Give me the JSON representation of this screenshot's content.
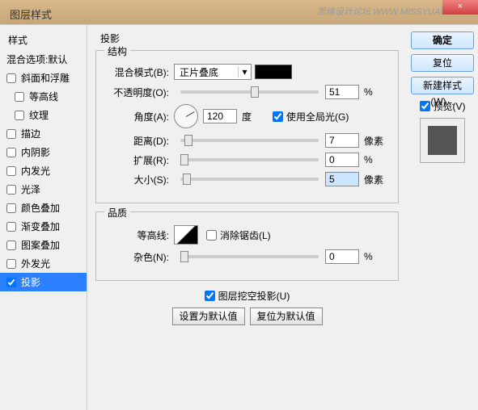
{
  "titlebar": {
    "title": "图层样式",
    "watermark": "思缘设计论坛 WWW.MISSYUAN.COM",
    "close": "×"
  },
  "sidebar": {
    "heading": "样式",
    "blend_defaults": "混合选项:默认",
    "items": [
      {
        "label": "斜面和浮雕",
        "checked": false
      },
      {
        "label": "等高线",
        "checked": false,
        "indent": true
      },
      {
        "label": "纹理",
        "checked": false,
        "indent": true
      },
      {
        "label": "描边",
        "checked": false
      },
      {
        "label": "内阴影",
        "checked": false
      },
      {
        "label": "内发光",
        "checked": false
      },
      {
        "label": "光泽",
        "checked": false
      },
      {
        "label": "颜色叠加",
        "checked": false
      },
      {
        "label": "渐变叠加",
        "checked": false
      },
      {
        "label": "图案叠加",
        "checked": false
      },
      {
        "label": "外发光",
        "checked": false
      },
      {
        "label": "投影",
        "checked": true,
        "selected": true
      }
    ]
  },
  "main": {
    "title": "投影",
    "structure": {
      "legend": "结构",
      "blend_mode_label": "混合模式(B):",
      "blend_mode_value": "正片叠底",
      "opacity_label": "不透明度(O):",
      "opacity_value": "51",
      "opacity_unit": "%",
      "angle_label": "角度(A):",
      "angle_value": "120",
      "angle_unit": "度",
      "global_light_label": "使用全局光(G)",
      "global_light_checked": true,
      "distance_label": "距离(D):",
      "distance_value": "7",
      "distance_unit": "像素",
      "spread_label": "扩展(R):",
      "spread_value": "0",
      "spread_unit": "%",
      "size_label": "大小(S):",
      "size_value": "5",
      "size_unit": "像素"
    },
    "quality": {
      "legend": "品质",
      "contour_label": "等高线:",
      "antialias_label": "消除锯齿(L)",
      "antialias_checked": false,
      "noise_label": "杂色(N):",
      "noise_value": "0",
      "noise_unit": "%"
    },
    "knockout_label": "图层挖空投影(U)",
    "knockout_checked": true,
    "set_default": "设置为默认值",
    "reset_default": "复位为默认值"
  },
  "right": {
    "ok": "确定",
    "reset": "复位",
    "new_style": "新建样式(W)...",
    "preview_label": "预览(V)",
    "preview_checked": true
  }
}
